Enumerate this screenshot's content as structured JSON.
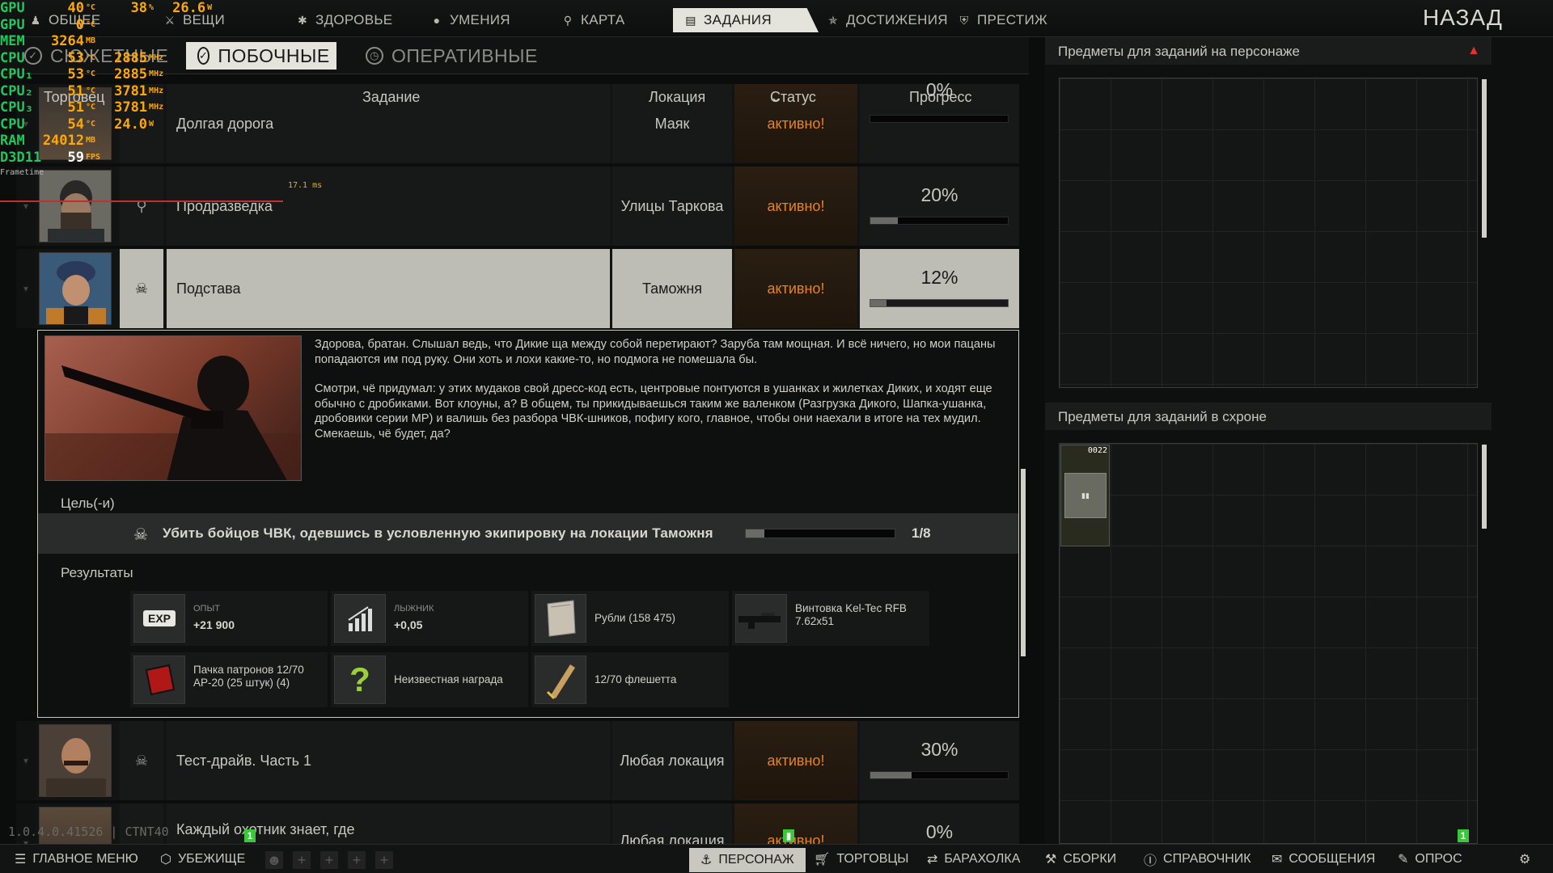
{
  "nav": {
    "tabs": [
      {
        "label": "ОБЩЕЕ",
        "icon": "person-icon"
      },
      {
        "label": "ВЕЩИ",
        "icon": "gear-icon"
      },
      {
        "label": "ЗДОРОВЬЕ",
        "icon": "health-icon"
      },
      {
        "label": "УМЕНИЯ",
        "icon": "skills-icon"
      },
      {
        "label": "КАРТА",
        "icon": "map-pin-icon"
      },
      {
        "label": "ЗАДАНИЯ",
        "icon": "tasks-icon"
      },
      {
        "label": "ДОСТИЖЕНИЯ",
        "icon": "achievement-icon"
      },
      {
        "label": "ПРЕСТИЖ",
        "icon": "prestige-icon"
      }
    ],
    "active": "ЗАДАНИЯ",
    "back": "НАЗАД"
  },
  "osd": {
    "rows": [
      {
        "label": "GPU",
        "v1": "40",
        "u1": "°C",
        "v2": "38",
        "u2": "%",
        "v3": "26.6",
        "u3": "W"
      },
      {
        "label": "GPU",
        "v1": "0",
        "u1": "°C",
        "v2": "",
        "u2": "",
        "v3": "",
        "u3": ""
      },
      {
        "label": "MEM",
        "v1": "3264",
        "u1": "MB",
        "v2": "",
        "u2": "",
        "v3": "",
        "u3": ""
      },
      {
        "label": "CPU",
        "v1": "53",
        "u1": "°C",
        "v2": "2885",
        "u2": "MHz",
        "v3": "",
        "u3": ""
      },
      {
        "label": "CPU₁",
        "v1": "53",
        "u1": "°C",
        "v2": "2885",
        "u2": "MHz",
        "v3": "",
        "u3": ""
      },
      {
        "label": "CPU₂",
        "v1": "51",
        "u1": "°C",
        "v2": "3781",
        "u2": "MHz",
        "v3": "",
        "u3": ""
      },
      {
        "label": "CPU₃",
        "v1": "51",
        "u1": "°C",
        "v2": "3781",
        "u2": "MHz",
        "v3": "",
        "u3": ""
      },
      {
        "label": "CPU",
        "v1": "54",
        "u1": "°C",
        "v2": "24.0",
        "u2": "W",
        "v3": "",
        "u3": ""
      },
      {
        "label": "RAM",
        "v1": "24012",
        "u1": "MB",
        "v2": "",
        "u2": "",
        "v3": "",
        "u3": ""
      },
      {
        "label": "D3D11",
        "v1": "59",
        "u1": "FPS",
        "v2": "",
        "u2": "",
        "v3": "",
        "u3": ""
      }
    ],
    "frametime_label": "Frametime",
    "frametime_ms": "17.1 ms"
  },
  "subtabs": [
    {
      "label": "СЮЖЕТНЫЕ",
      "icon": "story-icon"
    },
    {
      "label": "ПОБОЧНЫЕ",
      "icon": "check-circle-icon"
    },
    {
      "label": "ОПЕРАТИВНЫЕ",
      "icon": "clock-icon"
    }
  ],
  "table": {
    "headers": {
      "trader": "Торговец",
      "task": "Задание",
      "location": "Локация",
      "status": "Статус",
      "progress": "Прогресс"
    },
    "rows": [
      {
        "name": "Долгая дорога",
        "location": "Маяк",
        "status": "активно!",
        "progress": "0%",
        "fill": 0
      },
      {
        "name": "Продразведка",
        "location": "Улицы Таркова",
        "status": "активно!",
        "progress": "20%",
        "fill": 20
      },
      {
        "name": "Подстава",
        "location": "Таможня",
        "status": "активно!",
        "progress": "12%",
        "fill": 12
      },
      {
        "name": "Тест-драйв. Часть 1",
        "location": "Любая локация",
        "status": "активно!",
        "progress": "30%",
        "fill": 30
      },
      {
        "name": "Каждый охотник знает, где",
        "location": "Любая локация",
        "status": "активно!",
        "progress": "0%",
        "fill": 0
      }
    ]
  },
  "details": {
    "p1": "Здорова, братан. Слышал ведь, что Дикие ща между собой перетирают? Заруба там мощная. И всё ничего, но мои пацаны попадаются им под руку. Они хоть и лохи какие-то, но подмога не помешала бы.",
    "p2": "Смотри, чё придумал: у этих мудаков свой дресс-код есть, центровые понтуются в ушанках и жилетках Диких, и ходят еще обычно с дробиками. Вот клоуны, а? В общем, ты прикидываешься таким же валенком (Разгрузка Дикого, Шапка-ушанка, дробовики серии МР) и валишь без разбора ЧВК-шников, пофигу кого, главное, чтобы они наехали в итоге на тех мудил. Смекаешь, чё будет, да?",
    "goal_header": "Цель(-и)",
    "goal_text": "Убить бойцов ЧВК, одевшись в условленную экипировку на локации Таможня",
    "goal_count": "1/8",
    "goal_fill": 12.5,
    "results_header": "Результаты",
    "rewards": [
      {
        "icon": "EXP",
        "t1": "ОПЫТ",
        "t2": "+21 900"
      },
      {
        "icon": "skill-up-icon",
        "t1": "ЛЫЖНИК",
        "t2": "+0,05"
      },
      {
        "icon": "roubles-icon",
        "t3": "Рубли (158 475)"
      },
      {
        "icon": "rifle-icon",
        "t3": "Винтовка Kel-Tec RFB 7.62x51"
      },
      {
        "icon": "ammo-pack-icon",
        "t3": "Пачка патронов 12/70 AP-20 (25 штук) (4)"
      },
      {
        "icon": "?",
        "t3": "Неизвестная награда"
      },
      {
        "icon": "flechette-icon",
        "t3": "12/70 флешетта"
      }
    ]
  },
  "right": {
    "on_char": "Предметы для заданий на персонаже",
    "in_stash": "Предметы для заданий в схроне",
    "stash_item_count": "0022",
    "badge": "1"
  },
  "bottom": {
    "items": [
      {
        "label": "ГЛАВНОЕ МЕНЮ",
        "icon": "menu-icon"
      },
      {
        "label": "УБЕЖИЩЕ",
        "icon": "hideout-icon"
      },
      {
        "label": "ПЕРСОНАЖ",
        "icon": "character-icon"
      },
      {
        "label": "ТОРГОВЦЫ",
        "icon": "cart-icon"
      },
      {
        "label": "БАРАХОЛКА",
        "icon": "flea-icon"
      },
      {
        "label": "СБОРКИ",
        "icon": "builds-icon"
      },
      {
        "label": "СПРАВОЧНИК",
        "icon": "handbook-icon"
      },
      {
        "label": "СООБЩЕНИЯ",
        "icon": "messages-icon"
      },
      {
        "label": "ОПРОС",
        "icon": "survey-icon"
      }
    ],
    "active": "ПЕРСОНАЖ"
  },
  "version": "1.0.4.0.41526 | CTNT40",
  "colors": {
    "accent": "#e4e4dc",
    "status": "#e0852a",
    "osd_label": "#1ec85a",
    "osd_value": "#ffa800"
  }
}
